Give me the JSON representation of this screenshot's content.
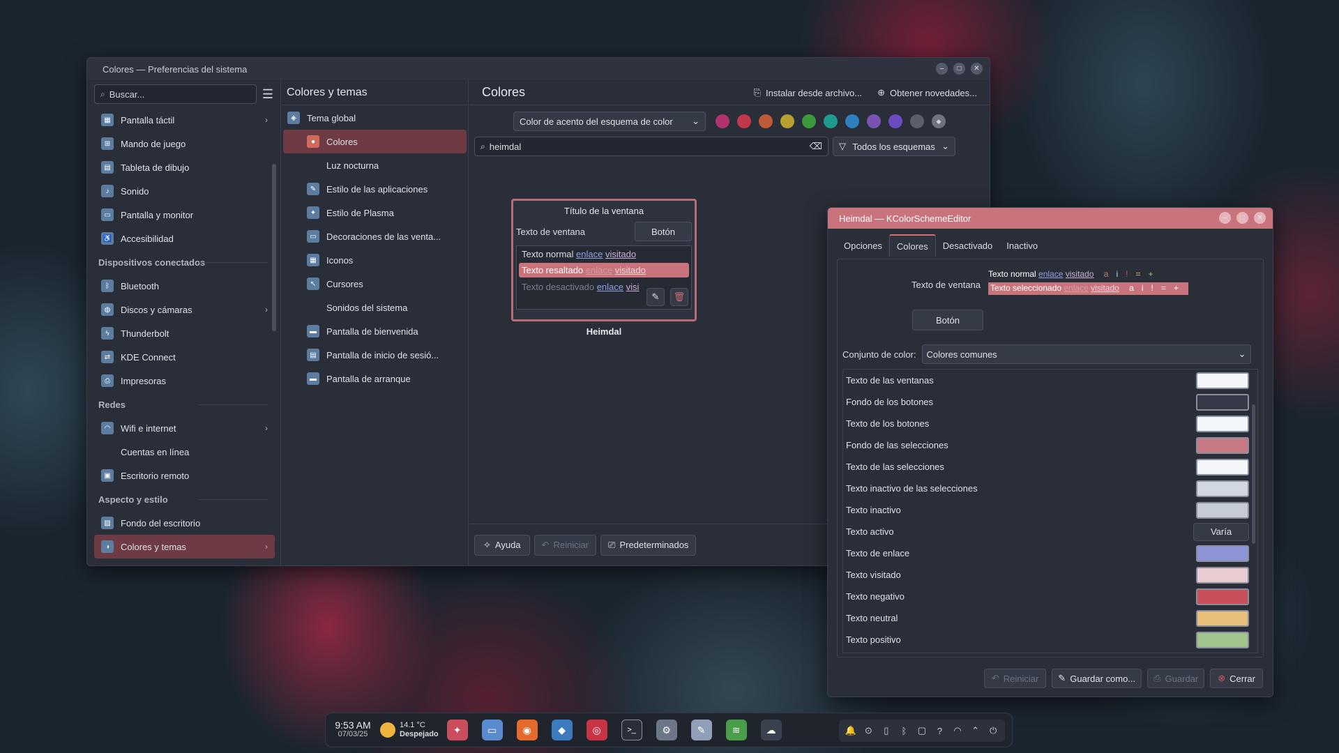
{
  "main_window": {
    "title": "Colores — Preferencias del sistema",
    "search_placeholder": "Buscar...",
    "sidebar": [
      {
        "type": "item",
        "label": "Pantalla táctil",
        "icon": "touchscreen-icon",
        "chevron": true
      },
      {
        "type": "item",
        "label": "Mando de juego",
        "icon": "gamepad-icon"
      },
      {
        "type": "item",
        "label": "Tableta de dibujo",
        "icon": "tablet-icon"
      },
      {
        "type": "item",
        "label": "Sonido",
        "icon": "sound-icon"
      },
      {
        "type": "item",
        "label": "Pantalla y monitor",
        "icon": "monitor-icon"
      },
      {
        "type": "item",
        "label": "Accesibilidad",
        "icon": "accessibility-icon"
      },
      {
        "type": "header",
        "label": "Dispositivos conectados"
      },
      {
        "type": "item",
        "label": "Bluetooth",
        "icon": "bluetooth-icon"
      },
      {
        "type": "item",
        "label": "Discos y cámaras",
        "icon": "disk-icon",
        "chevron": true
      },
      {
        "type": "item",
        "label": "Thunderbolt",
        "icon": "thunderbolt-icon"
      },
      {
        "type": "item",
        "label": "KDE Connect",
        "icon": "kde-connect-icon"
      },
      {
        "type": "item",
        "label": "Impresoras",
        "icon": "printer-icon"
      },
      {
        "type": "header",
        "label": "Redes"
      },
      {
        "type": "item",
        "label": "Wifi e internet",
        "icon": "wifi-icon",
        "chevron": true
      },
      {
        "type": "item",
        "label": "Cuentas en línea",
        "icon": "accounts-icon"
      },
      {
        "type": "item",
        "label": "Escritorio remoto",
        "icon": "remote-desktop-icon"
      },
      {
        "type": "header",
        "label": "Aspecto y estilo"
      },
      {
        "type": "item",
        "label": "Fondo del escritorio",
        "icon": "wallpaper-icon"
      },
      {
        "type": "item",
        "label": "Colores y temas",
        "icon": "themes-icon",
        "chevron": true,
        "active": true
      }
    ],
    "category_title": "Colores y temas",
    "categories": [
      {
        "label": "Tema global",
        "icon": "global-theme-icon",
        "level": 0
      },
      {
        "label": "Colores",
        "icon": "colors-icon",
        "level": 1,
        "active": true
      },
      {
        "label": "Luz nocturna",
        "icon": "",
        "level": 1
      },
      {
        "label": "Estilo de las aplicaciones",
        "icon": "app-style-icon",
        "level": 1
      },
      {
        "label": "Estilo de Plasma",
        "icon": "plasma-style-icon",
        "level": 1
      },
      {
        "label": "Decoraciones de las venta...",
        "icon": "window-decorations-icon",
        "level": 1
      },
      {
        "label": "Iconos",
        "icon": "icons-icon",
        "level": 1
      },
      {
        "label": "Cursores",
        "icon": "cursor-icon",
        "level": 1
      },
      {
        "label": "Sonidos del sistema",
        "icon": "",
        "level": 1
      },
      {
        "label": "Pantalla de bienvenida",
        "icon": "splash-icon",
        "level": 1
      },
      {
        "label": "Pantalla de inicio de sesió...",
        "icon": "login-icon",
        "level": 1
      },
      {
        "label": "Pantalla de arranque",
        "icon": "boot-icon",
        "level": 1
      }
    ],
    "page_title": "Colores",
    "install_label": "Instalar desde archivo...",
    "get_new_label": "Obtener novedades...",
    "accent_select": "Color de acento del esquema de color",
    "accent_colors": [
      "#b0336e",
      "#c0394a",
      "#bf5a36",
      "#b6a030",
      "#3c9a3c",
      "#1e9a90",
      "#2f7fbf",
      "#7a52b4",
      "#6a4cc0",
      "#5a5f6c",
      "#6e7380"
    ],
    "filter_value": "heimdal",
    "filter_select": "Todos los esquemas",
    "preview": {
      "window_title": "Título de la ventana",
      "window_text": "Texto de ventana",
      "button": "Botón",
      "normal": "Texto normal",
      "link": "enlace",
      "visited": "visitado",
      "highlighted": "Texto resaltado",
      "disabled": "Texto desactivado",
      "visited_cut": "visi",
      "scheme_name": "Heimdal"
    },
    "bottom": {
      "help": "Ayuda",
      "reset": "Reiniciar",
      "defaults": "Predeterminados"
    }
  },
  "editor": {
    "title": "Heimdal — KColorSchemeEditor",
    "tabs": [
      "Opciones",
      "Colores",
      "Desactivado",
      "Inactivo"
    ],
    "preview": {
      "window_text": "Texto de ventana",
      "normal": "Texto normal",
      "link": "enlace",
      "visited": "visitado",
      "selected": "Texto seleccionado",
      "symbols": [
        "a",
        "i",
        "!",
        "=",
        "+"
      ],
      "button": "Botón"
    },
    "color_set_label": "Conjunto de color:",
    "color_set_value": "Colores comunes",
    "rows": [
      {
        "label": "Texto de las ventanas",
        "color": "#f4f6f9"
      },
      {
        "label": "Fondo de los botones",
        "color": "#343a48"
      },
      {
        "label": "Texto de los botones",
        "color": "#f4f6f9"
      },
      {
        "label": "Fondo de las selecciones",
        "color": "#c87a84"
      },
      {
        "label": "Texto de las selecciones",
        "color": "#f4f6f9"
      },
      {
        "label": "Texto inactivo de las selecciones",
        "color": "#d2d8e2"
      },
      {
        "label": "Texto inactivo",
        "color": "#c6ccd6"
      },
      {
        "label": "Texto activo",
        "varies": "Varía"
      },
      {
        "label": "Texto de enlace",
        "color": "#8c94d6"
      },
      {
        "label": "Texto visitado",
        "color": "#e8ccd2"
      },
      {
        "label": "Texto negativo",
        "color": "#c8505a"
      },
      {
        "label": "Texto neutral",
        "color": "#e8c07a"
      },
      {
        "label": "Texto positivo",
        "color": "#a0c48c"
      }
    ],
    "buttons": {
      "reset": "Reiniciar",
      "save_as": "Guardar como...",
      "save": "Guardar",
      "close": "Cerrar"
    }
  },
  "taskbar": {
    "time": "9:53 AM",
    "date": "07/03/25",
    "temp": "14.1 °C",
    "weather": "Despejado",
    "apps": [
      {
        "name": "launcher-icon",
        "color": "#c94f5e",
        "glyph": "✦"
      },
      {
        "name": "files-icon",
        "color": "#5a8ad0",
        "glyph": "▭"
      },
      {
        "name": "firefox-icon",
        "color": "#e46b2d",
        "glyph": "◉"
      },
      {
        "name": "code-editor-icon",
        "color": "#3d7bbf",
        "glyph": "◆"
      },
      {
        "name": "eye-app-icon",
        "color": "#c93444",
        "glyph": "◎"
      },
      {
        "name": "terminal-icon",
        "color": "#2a2e38",
        "glyph": ">_"
      },
      {
        "name": "settings-app-icon",
        "color": "#6c7686",
        "glyph": "⚙"
      },
      {
        "name": "writer-icon",
        "color": "#8fa0b8",
        "glyph": "✎"
      },
      {
        "name": "spotify-icon",
        "color": "#4a9e4a",
        "glyph": "≋"
      },
      {
        "name": "helper-icon",
        "color": "#3a4250",
        "glyph": "☁"
      }
    ],
    "tray": [
      "notifications-icon",
      "updates-icon",
      "clipboard-icon",
      "bluetooth-icon",
      "file-icon",
      "help-icon",
      "network-icon",
      "expand-icon",
      "power-icon"
    ]
  }
}
